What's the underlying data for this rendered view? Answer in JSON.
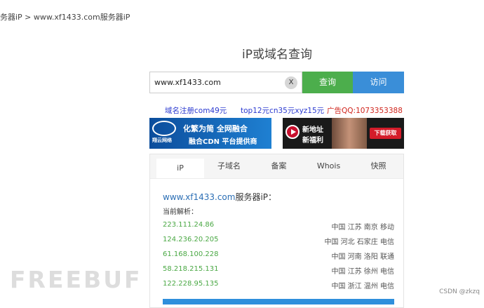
{
  "breadcrumb": "务器iP > www.xf1433.com服务器iP",
  "title": "iP或域名查询",
  "search": {
    "value": "www.xf1433.com",
    "clear_label": "X",
    "query_label": "查询",
    "visit_label": "访问"
  },
  "ads": {
    "left": "域名注册com49元",
    "middle": "top12元cn35元xyz15元",
    "right": "广告QQ:1073353388"
  },
  "banner1": {
    "logo_text": "翔云网络",
    "line1": "化繁为简 全网融合",
    "line2": "融合CDN 平台提供商"
  },
  "banner2": {
    "line1": "新地址",
    "line2": "新福利",
    "button": "下载获取"
  },
  "tabs": [
    "iP",
    "子域名",
    "备案",
    "Whois",
    "快照"
  ],
  "result": {
    "domain": "www.xf1433.com",
    "suffix": "服务器iP：",
    "parse_label": "当前解析："
  },
  "records": [
    {
      "ip": "223.111.24.86",
      "location": "中国 江苏 南京 移动"
    },
    {
      "ip": "124.236.20.205",
      "location": "中国 河北 石家庄 电信"
    },
    {
      "ip": "61.168.100.228",
      "location": "中国 河南 洛阳 联通"
    },
    {
      "ip": "58.218.215.131",
      "location": "中国 江苏 徐州 电信"
    },
    {
      "ip": "122.228.95.135",
      "location": "中国 浙江 温州 电信"
    }
  ],
  "watermark": "FREEBUF",
  "csdn": "CSDN @zkzq",
  "colors": {
    "query_button": "#4cae4c",
    "visit_button": "#3a8ed8",
    "ip_text": "#4aa844",
    "ad_blue": "#2b3ad0",
    "ad_red": "#d0241c"
  }
}
